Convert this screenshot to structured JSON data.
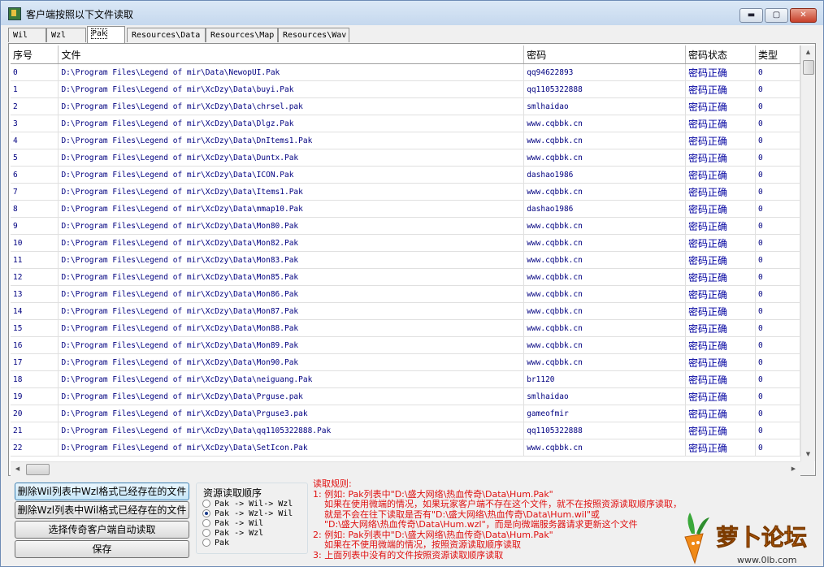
{
  "window": {
    "title": "客户端按照以下文件读取",
    "min_glyph": "▬",
    "max_glyph": "▢",
    "close_glyph": "✕"
  },
  "tabs": [
    "Wil",
    "Wzl",
    "Pak",
    "Resources\\Data",
    "Resources\\Map",
    "Resources\\Wav"
  ],
  "active_tab": "Pak",
  "table": {
    "columns": [
      "序号",
      "文件",
      "密码",
      "密码状态",
      "类型"
    ],
    "rows": [
      [
        "0",
        "D:\\Program Files\\Legend of mir\\Data\\NewopUI.Pak",
        "qq94622893",
        "密码正确",
        "0"
      ],
      [
        "1",
        "D:\\Program Files\\Legend of mir\\XcDzy\\Data\\buyi.Pak",
        "qq1105322888",
        "密码正确",
        "0"
      ],
      [
        "2",
        "D:\\Program Files\\Legend of mir\\XcDzy\\Data\\chrsel.pak",
        "smlhaidao",
        "密码正确",
        "0"
      ],
      [
        "3",
        "D:\\Program Files\\Legend of mir\\XcDzy\\Data\\Dlgz.Pak",
        "www.cqbbk.cn",
        "密码正确",
        "0"
      ],
      [
        "4",
        "D:\\Program Files\\Legend of mir\\XcDzy\\Data\\DnItems1.Pak",
        "www.cqbbk.cn",
        "密码正确",
        "0"
      ],
      [
        "5",
        "D:\\Program Files\\Legend of mir\\XcDzy\\Data\\Duntx.Pak",
        "www.cqbbk.cn",
        "密码正确",
        "0"
      ],
      [
        "6",
        "D:\\Program Files\\Legend of mir\\XcDzy\\Data\\ICON.Pak",
        "dashao1986",
        "密码正确",
        "0"
      ],
      [
        "7",
        "D:\\Program Files\\Legend of mir\\XcDzy\\Data\\Items1.Pak",
        "www.cqbbk.cn",
        "密码正确",
        "0"
      ],
      [
        "8",
        "D:\\Program Files\\Legend of mir\\XcDzy\\Data\\mmap10.Pak",
        "dashao1986",
        "密码正确",
        "0"
      ],
      [
        "9",
        "D:\\Program Files\\Legend of mir\\XcDzy\\Data\\Mon80.Pak",
        "www.cqbbk.cn",
        "密码正确",
        "0"
      ],
      [
        "10",
        "D:\\Program Files\\Legend of mir\\XcDzy\\Data\\Mon82.Pak",
        "www.cqbbk.cn",
        "密码正确",
        "0"
      ],
      [
        "11",
        "D:\\Program Files\\Legend of mir\\XcDzy\\Data\\Mon83.Pak",
        "www.cqbbk.cn",
        "密码正确",
        "0"
      ],
      [
        "12",
        "D:\\Program Files\\Legend of mir\\XcDzy\\Data\\Mon85.Pak",
        "www.cqbbk.cn",
        "密码正确",
        "0"
      ],
      [
        "13",
        "D:\\Program Files\\Legend of mir\\XcDzy\\Data\\Mon86.Pak",
        "www.cqbbk.cn",
        "密码正确",
        "0"
      ],
      [
        "14",
        "D:\\Program Files\\Legend of mir\\XcDzy\\Data\\Mon87.Pak",
        "www.cqbbk.cn",
        "密码正确",
        "0"
      ],
      [
        "15",
        "D:\\Program Files\\Legend of mir\\XcDzy\\Data\\Mon88.Pak",
        "www.cqbbk.cn",
        "密码正确",
        "0"
      ],
      [
        "16",
        "D:\\Program Files\\Legend of mir\\XcDzy\\Data\\Mon89.Pak",
        "www.cqbbk.cn",
        "密码正确",
        "0"
      ],
      [
        "17",
        "D:\\Program Files\\Legend of mir\\XcDzy\\Data\\Mon90.Pak",
        "www.cqbbk.cn",
        "密码正确",
        "0"
      ],
      [
        "18",
        "D:\\Program Files\\Legend of mir\\XcDzy\\Data\\neiguang.Pak",
        "br1120",
        "密码正确",
        "0"
      ],
      [
        "19",
        "D:\\Program Files\\Legend of mir\\XcDzy\\Data\\Prguse.pak",
        "smlhaidao",
        "密码正确",
        "0"
      ],
      [
        "20",
        "D:\\Program Files\\Legend of mir\\XcDzy\\Data\\Prguse3.pak",
        "gameofmir",
        "密码正确",
        "0"
      ],
      [
        "21",
        "D:\\Program Files\\Legend of mir\\XcDzy\\Data\\qq1105322888.Pak",
        "qq1105322888",
        "密码正确",
        "0"
      ],
      [
        "22",
        "D:\\Program Files\\Legend of mir\\XcDzy\\Data\\SetIcon.Pak",
        "www.cqbbk.cn",
        "密码正确",
        "0"
      ]
    ]
  },
  "buttons": {
    "delete_wil": "删除Wil列表中Wzl格式已经存在的文件",
    "delete_wzl": "删除Wzl列表中Wil格式已经存在的文件",
    "select_client": "选择传奇客户端自动读取",
    "save": "保存"
  },
  "read_order": {
    "title": "资源读取顺序",
    "options": [
      "Pak -> Wil-> Wzl",
      "Pak -> Wzl-> Wil",
      "Pak -> Wil",
      "Pak -> Wzl",
      "Pak"
    ],
    "selected_index": 1
  },
  "rules": {
    "lines": [
      "读取规则:",
      "1: 例如: Pak列表中\"D:\\盛大网络\\热血传奇\\Data\\Hum.Pak\"",
      "    如果在使用微端的情况，如果玩家客户端不存在这个文件，就不在按照资源读取顺序读取，",
      "    就是不会在往下读取是否有\"D:\\盛大网络\\热血传奇\\Data\\Hum.wil\"或",
      "    \"D:\\盛大网络\\热血传奇\\Data\\Hum.wzl\"，而是向微端服务器请求更新这个文件",
      "2: 例如: Pak列表中\"D:\\盛大网络\\热血传奇\\Data\\Hum.Pak\"",
      "    如果在不使用微端的情况，按照资源读取顺序读取",
      "3: 上面列表中没有的文件按照资源读取顺序读取"
    ]
  },
  "watermark": {
    "text": "萝卜论坛",
    "url_text": "www.0lb.com"
  },
  "colors": {
    "rules_text": "#e01010",
    "cell_text": "#000080",
    "status_text": "#0000a0",
    "watermark_orange": "#f07a10"
  }
}
